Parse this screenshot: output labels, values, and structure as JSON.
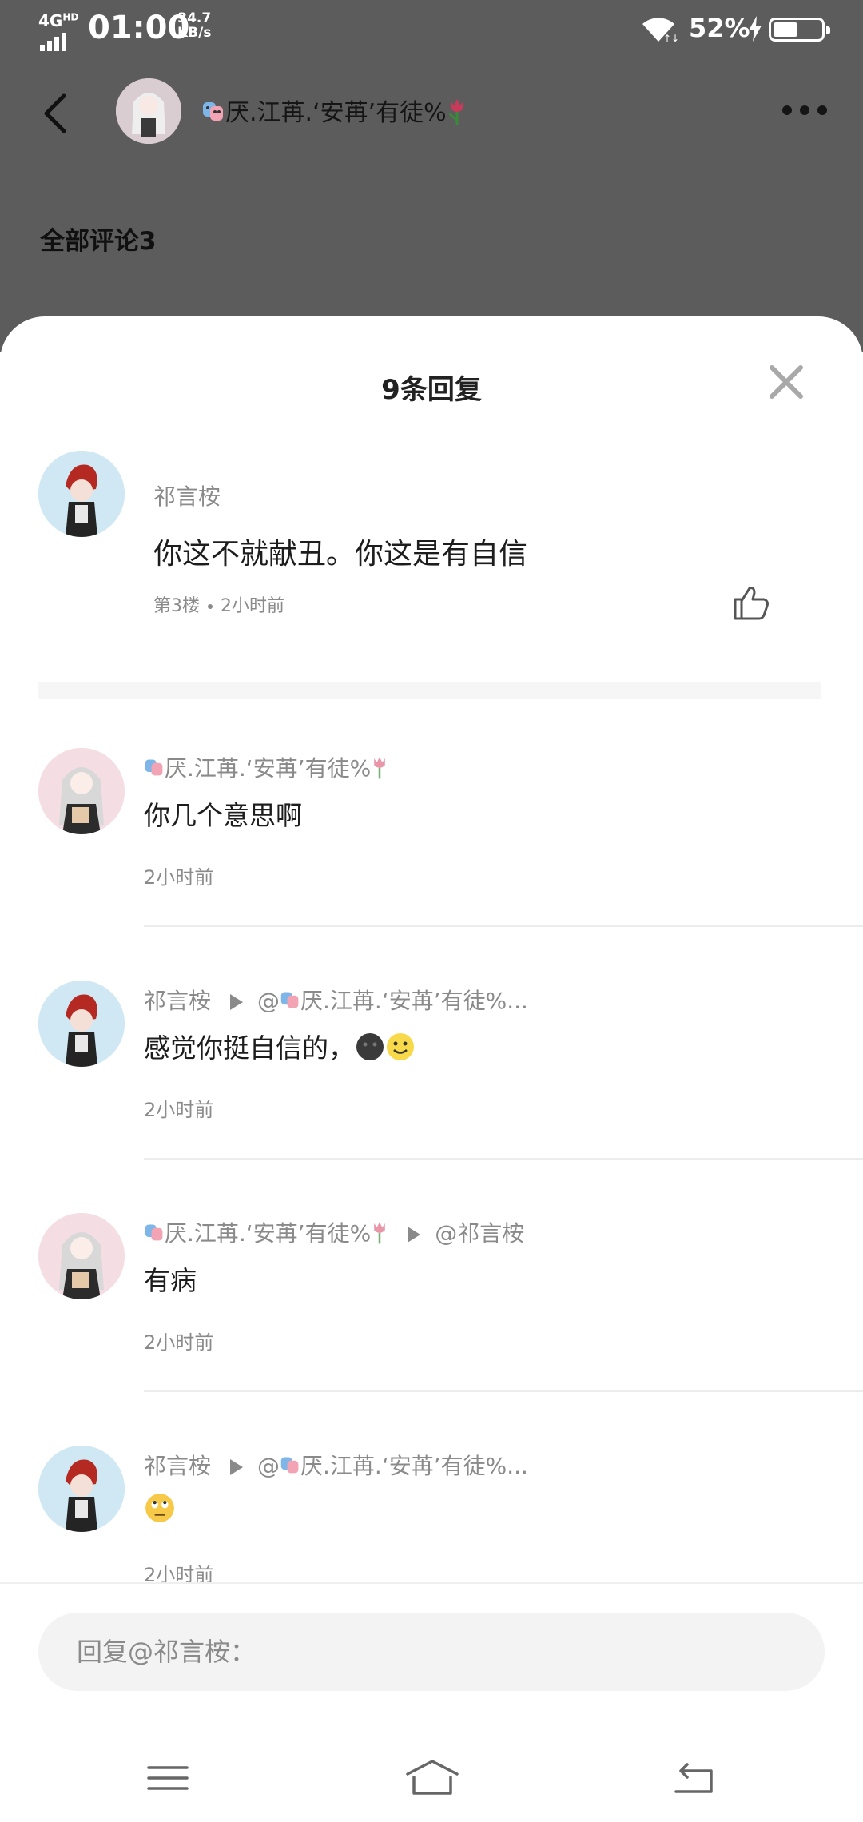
{
  "status_bar": {
    "network": "4G",
    "network_sup": "HD",
    "time": "01:00",
    "speed_value": "34.7",
    "speed_unit": "KB/s",
    "battery_percent": "52%",
    "battery_level": 0.52
  },
  "header": {
    "user_name": "厌.江苒.‘安苒’有徒%",
    "all_comments": "全部评论3"
  },
  "sheet": {
    "title": "9条回复",
    "main_comment": {
      "user": "祁言桉",
      "text": "你这不就献丑。你这是有自信",
      "floor": "第3楼",
      "time": "2小时前"
    },
    "replies": [
      {
        "user": "厌.江苒.‘安苒’有徒%",
        "to": "",
        "text": "你几个意思啊",
        "time": "2小时前",
        "avatar": "girl"
      },
      {
        "user": "祁言桉",
        "to": "@厌.江苒.‘安苒’有徒%...",
        "text": "感觉你挺自信的，",
        "time": "2小时前",
        "avatar": "boy"
      },
      {
        "user": "厌.江苒.‘安苒’有徒%",
        "to": "@祁言桉",
        "text": "有病",
        "time": "2小时前",
        "avatar": "girl"
      },
      {
        "user": "祁言桉",
        "to": "@厌.江苒.‘安苒’有徒%...",
        "text": "",
        "time": "2小时前",
        "avatar": "boy"
      }
    ]
  },
  "input": {
    "placeholder": "回复@祁言桉："
  },
  "colors": {
    "dim_background": "#5c5c5c",
    "secondary_text": "#8a8a8a",
    "primary_text": "#1d1d1d"
  },
  "icons": [
    "back-icon",
    "more-icon",
    "close-icon",
    "like-icon",
    "menu-icon",
    "home-icon",
    "return-icon",
    "masks-emoji",
    "tulip-emoji",
    "dark-face-emoji",
    "smile-emoji",
    "eye-roll-emoji"
  ]
}
